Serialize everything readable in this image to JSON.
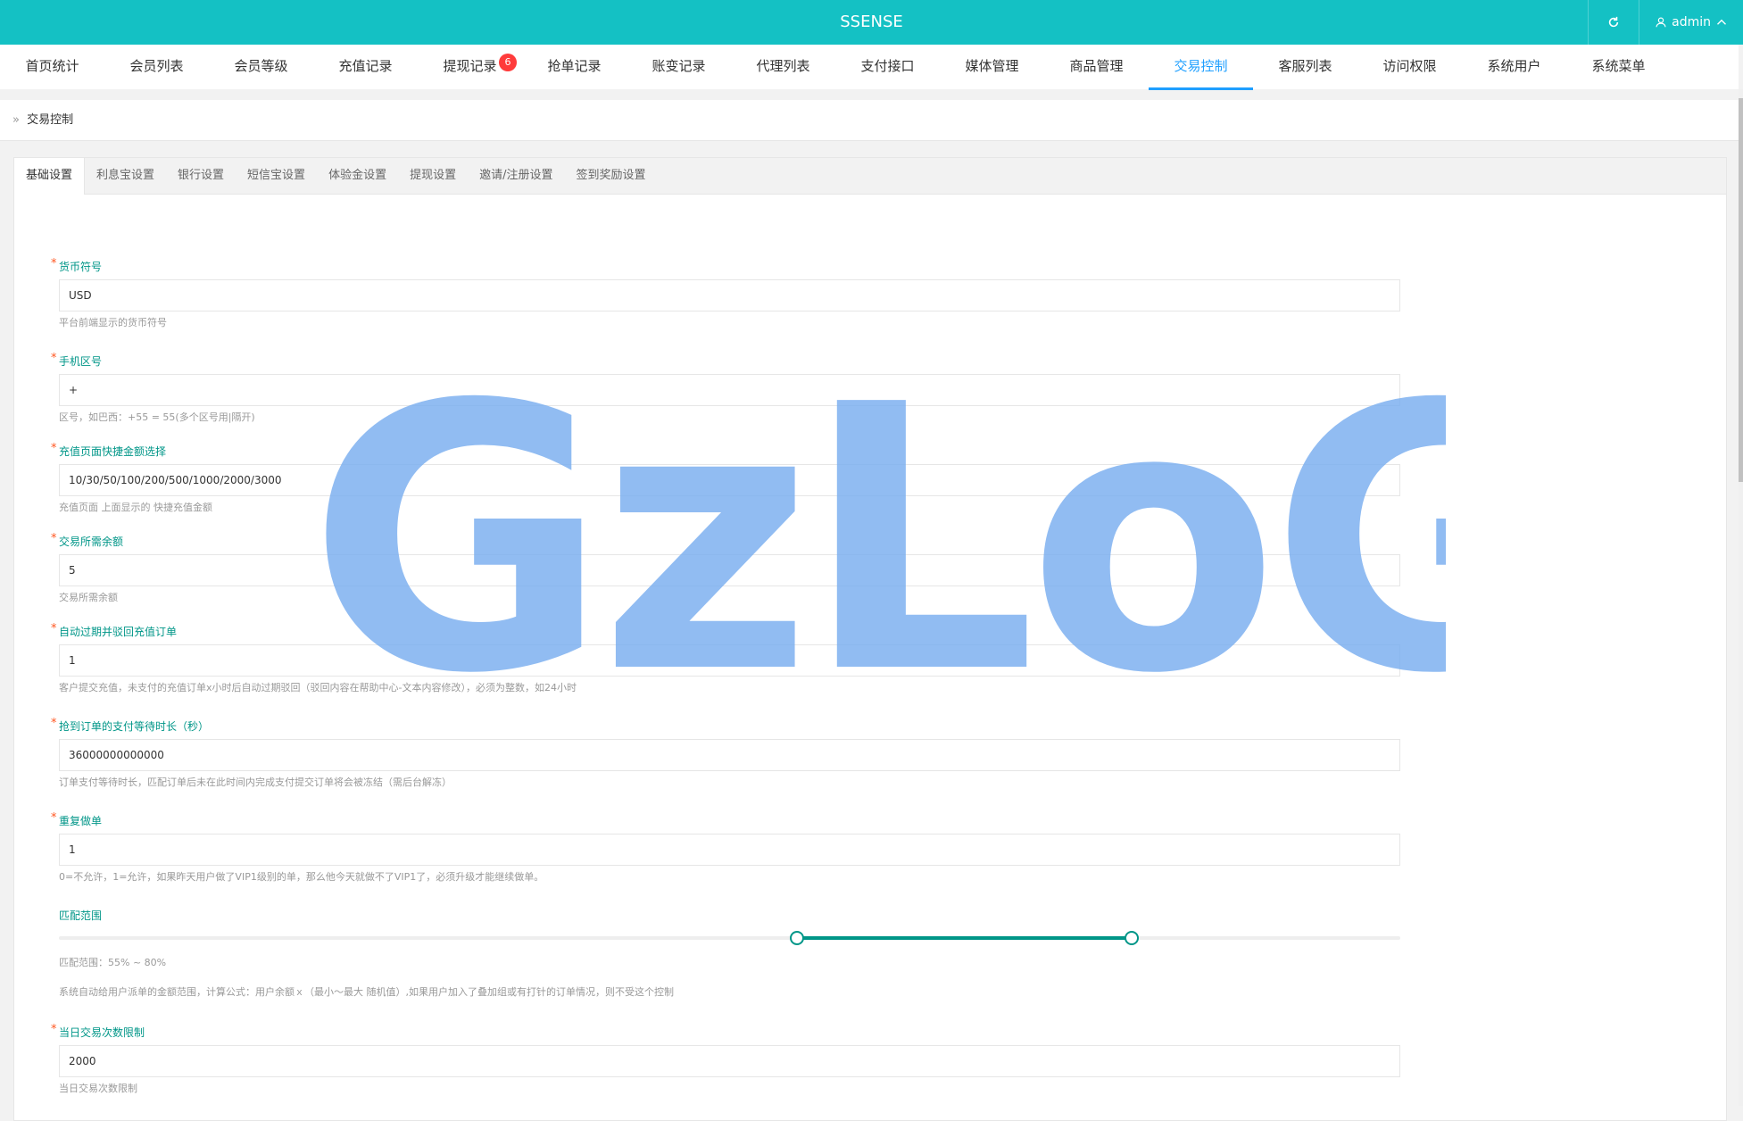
{
  "app": {
    "brand": "SSENSE",
    "user": "admin",
    "refresh_icon": "refresh-icon",
    "user_icon": "user-icon",
    "chevron_icon": "chevron-up-icon"
  },
  "nav": {
    "items": [
      {
        "label": "首页统计"
      },
      {
        "label": "会员列表"
      },
      {
        "label": "会员等级"
      },
      {
        "label": "充值记录"
      },
      {
        "label": "提现记录",
        "badge": "6"
      },
      {
        "label": "抢单记录"
      },
      {
        "label": "账变记录"
      },
      {
        "label": "代理列表"
      },
      {
        "label": "支付接口"
      },
      {
        "label": "媒体管理"
      },
      {
        "label": "商品管理"
      },
      {
        "label": "交易控制",
        "active": true
      },
      {
        "label": "客服列表"
      },
      {
        "label": "访问权限"
      },
      {
        "label": "系统用户"
      },
      {
        "label": "系统菜单"
      }
    ]
  },
  "breadcrumb": {
    "separator": "»",
    "current": "交易控制"
  },
  "tabs": [
    "基础设置",
    "利息宝设置",
    "银行设置",
    "短信宝设置",
    "体验金设置",
    "提现设置",
    "邀请/注册设置",
    "签到奖励设置"
  ],
  "form": {
    "currency": {
      "label": "货币符号",
      "value": "USD",
      "help": "平台前端显示的货币符号"
    },
    "phone_code": {
      "label": "手机区号",
      "value": "+",
      "help": "区号，如巴西：+55 = 55(多个区号用|隔开)"
    },
    "quick_amounts": {
      "label": "充值页面快捷金额选择",
      "value": "10/30/50/100/200/500/1000/2000/3000",
      "help": "充值页面 上面显示的 快捷充值金额"
    },
    "min_balance": {
      "label": "交易所需余额",
      "value": "5",
      "help": "交易所需余额"
    },
    "auto_expire": {
      "label": "自动过期并驳回充值订单",
      "value": "1",
      "help": "客户提交充值，未支付的充值订单x小时后自动过期驳回（驳回内容在帮助中心-文本内容修改），必须为整数，如24小时"
    },
    "pay_wait": {
      "label": "抢到订单的支付等待时长（秒）",
      "value": "36000000000000",
      "help": "订单支付等待时长，匹配订单后未在此时间内完成支付提交订单将会被冻结（需后台解冻）"
    },
    "repeat": {
      "label": "重复做单",
      "value": "1",
      "help": "0=不允许，1=允许，如果昨天用户做了VIP1级别的单，那么他今天就做不了VIP1了，必须升级才能继续做单。"
    },
    "match_range": {
      "label": "匹配范围",
      "min": 55,
      "max": 80,
      "range_text": "匹配范围：55% ~ 80%",
      "help": "系统自动给用户派单的金额范围，计算公式：用户余额ｘ（最小～最大 随机值）,如果用户加入了叠加组或有打针的订单情况，则不受这个控制"
    },
    "daily_limit": {
      "label": "当日交易次数限制",
      "value": "2000",
      "help": "当日交易次数限制"
    }
  },
  "watermark": "GzLoG",
  "colors": {
    "topbar": "#14c1c4",
    "accent": "#1e9fff",
    "label": "#009688",
    "badge": "#ff3b3b"
  }
}
